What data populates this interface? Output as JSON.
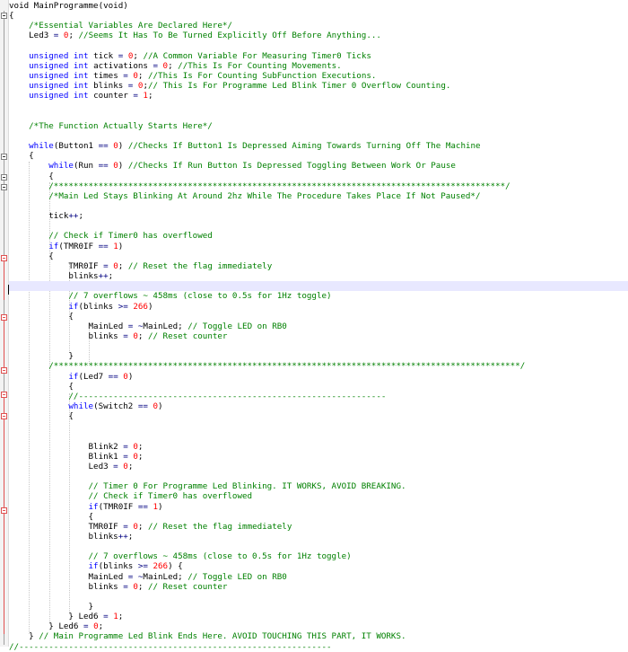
{
  "editor": {
    "colors": {
      "background": "#ffffff",
      "keyword": "#0000ff",
      "number": "#ff0000",
      "comment": "#008000",
      "text": "#000000",
      "current_line": "#e8e8ff",
      "fold_marker_changed": "#e05050"
    },
    "lines": [
      [
        [
          "t",
          "void MainProgramme(void)"
        ]
      ],
      [
        [
          "t",
          "{"
        ]
      ],
      [
        [
          "t",
          "    "
        ],
        [
          "c",
          "/*Essential Variables Are Declared Here*/"
        ]
      ],
      [
        [
          "t",
          "    Led3 "
        ],
        [
          "o",
          "="
        ],
        [
          "t",
          " "
        ],
        [
          "n",
          "0"
        ],
        [
          "t",
          "; "
        ],
        [
          "c",
          "//Seems It Has To Be Turned Explicitly Off Before Anything..."
        ]
      ],
      [],
      [
        [
          "t",
          "    "
        ],
        [
          "k",
          "unsigned int"
        ],
        [
          "t",
          " tick "
        ],
        [
          "o",
          "="
        ],
        [
          "t",
          " "
        ],
        [
          "n",
          "0"
        ],
        [
          "t",
          "; "
        ],
        [
          "c",
          "//A Common Variable For Measuring Timer0 Ticks"
        ]
      ],
      [
        [
          "t",
          "    "
        ],
        [
          "k",
          "unsigned int"
        ],
        [
          "t",
          " activations "
        ],
        [
          "o",
          "="
        ],
        [
          "t",
          " "
        ],
        [
          "n",
          "0"
        ],
        [
          "t",
          "; "
        ],
        [
          "c",
          "//This Is For Counting Movements."
        ]
      ],
      [
        [
          "t",
          "    "
        ],
        [
          "k",
          "unsigned int"
        ],
        [
          "t",
          " times "
        ],
        [
          "o",
          "="
        ],
        [
          "t",
          " "
        ],
        [
          "n",
          "0"
        ],
        [
          "t",
          "; "
        ],
        [
          "c",
          "//This Is For Counting SubFunction Executions."
        ]
      ],
      [
        [
          "t",
          "    "
        ],
        [
          "k",
          "unsigned int"
        ],
        [
          "t",
          " blinks "
        ],
        [
          "o",
          "="
        ],
        [
          "t",
          " "
        ],
        [
          "n",
          "0"
        ],
        [
          "t",
          ";"
        ],
        [
          "c",
          "// This Is For Programme Led Blink Timer 0 Overflow Counting."
        ]
      ],
      [
        [
          "t",
          "    "
        ],
        [
          "k",
          "unsigned int"
        ],
        [
          "t",
          " counter "
        ],
        [
          "o",
          "="
        ],
        [
          "t",
          " "
        ],
        [
          "n",
          "1"
        ],
        [
          "t",
          ";"
        ]
      ],
      [],
      [],
      [
        [
          "t",
          "    "
        ],
        [
          "c",
          "/*The Function Actually Starts Here*/"
        ]
      ],
      [],
      [
        [
          "t",
          "    "
        ],
        [
          "k",
          "while"
        ],
        [
          "t",
          "(Button1 "
        ],
        [
          "o",
          "=="
        ],
        [
          "t",
          " "
        ],
        [
          "n",
          "0"
        ],
        [
          "t",
          ") "
        ],
        [
          "c",
          "//Checks If Button1 Is Depressed Aiming Towards Turning Off The Machine"
        ]
      ],
      [
        [
          "t",
          "    {"
        ]
      ],
      [
        [
          "t",
          "        "
        ],
        [
          "k",
          "while"
        ],
        [
          "t",
          "(Run "
        ],
        [
          "o",
          "=="
        ],
        [
          "t",
          " "
        ],
        [
          "n",
          "0"
        ],
        [
          "t",
          ") "
        ],
        [
          "c",
          "//Checks If Run Button Is Depressed Toggling Between Work Or Pause"
        ]
      ],
      [
        [
          "t",
          "        {"
        ]
      ],
      [
        [
          "t",
          "        "
        ],
        [
          "c",
          "/*******************************************************************************************/"
        ]
      ],
      [
        [
          "t",
          "        "
        ],
        [
          "c",
          "/*Main Led Stays Blinking At Around 2hz While The Procedure Takes Place If Not Paused*/"
        ]
      ],
      [],
      [
        [
          "t",
          "        tick"
        ],
        [
          "o",
          "++"
        ],
        [
          "t",
          ";"
        ]
      ],
      [],
      [
        [
          "t",
          "        "
        ],
        [
          "c",
          "// Check if Timer0 has overflowed"
        ]
      ],
      [
        [
          "t",
          "        "
        ],
        [
          "k",
          "if"
        ],
        [
          "t",
          "(TMR0IF "
        ],
        [
          "o",
          "=="
        ],
        [
          "t",
          " "
        ],
        [
          "n",
          "1"
        ],
        [
          "t",
          ")"
        ]
      ],
      [
        [
          "t",
          "        {"
        ]
      ],
      [
        [
          "t",
          "            TMR0IF "
        ],
        [
          "o",
          "="
        ],
        [
          "t",
          " "
        ],
        [
          "n",
          "0"
        ],
        [
          "t",
          "; "
        ],
        [
          "c",
          "// Reset the flag immediately"
        ]
      ],
      [
        [
          "t",
          "            blinks"
        ],
        [
          "o",
          "++"
        ],
        [
          "t",
          ";"
        ]
      ],
      [],
      [
        [
          "t",
          "            "
        ],
        [
          "c",
          "// 7 overflows ~ 458ms (close to 0.5s for 1Hz toggle)"
        ]
      ],
      [
        [
          "t",
          "            "
        ],
        [
          "k",
          "if"
        ],
        [
          "t",
          "(blinks "
        ],
        [
          "o",
          ">="
        ],
        [
          "t",
          " "
        ],
        [
          "n",
          "266"
        ],
        [
          "t",
          ")"
        ]
      ],
      [
        [
          "t",
          "            {"
        ]
      ],
      [
        [
          "t",
          "                MainLed "
        ],
        [
          "o",
          "="
        ],
        [
          "t",
          " "
        ],
        [
          "o",
          "~"
        ],
        [
          "t",
          "MainLed; "
        ],
        [
          "c",
          "// Toggle LED on RB0"
        ]
      ],
      [
        [
          "t",
          "                blinks "
        ],
        [
          "o",
          "="
        ],
        [
          "t",
          " "
        ],
        [
          "n",
          "0"
        ],
        [
          "t",
          "; "
        ],
        [
          "c",
          "// Reset counter"
        ]
      ],
      [],
      [
        [
          "t",
          "            }"
        ]
      ],
      [
        [
          "t",
          "        "
        ],
        [
          "c",
          "/**********************************************************************************************/"
        ]
      ],
      [
        [
          "t",
          "            "
        ],
        [
          "k",
          "if"
        ],
        [
          "t",
          "(Led7 "
        ],
        [
          "o",
          "=="
        ],
        [
          "t",
          " "
        ],
        [
          "n",
          "0"
        ],
        [
          "t",
          ")"
        ]
      ],
      [
        [
          "t",
          "            {"
        ]
      ],
      [
        [
          "t",
          "            "
        ],
        [
          "c",
          "//--------------------------------------------------------------"
        ]
      ],
      [
        [
          "t",
          "            "
        ],
        [
          "k",
          "while"
        ],
        [
          "t",
          "(Switch2 "
        ],
        [
          "o",
          "=="
        ],
        [
          "t",
          " "
        ],
        [
          "n",
          "0"
        ],
        [
          "t",
          ")"
        ]
      ],
      [
        [
          "t",
          "            {"
        ]
      ],
      [],
      [],
      [
        [
          "t",
          "                Blink2 "
        ],
        [
          "o",
          "="
        ],
        [
          "t",
          " "
        ],
        [
          "n",
          "0"
        ],
        [
          "t",
          ";"
        ]
      ],
      [
        [
          "t",
          "                Blink1 "
        ],
        [
          "o",
          "="
        ],
        [
          "t",
          " "
        ],
        [
          "n",
          "0"
        ],
        [
          "t",
          ";"
        ]
      ],
      [
        [
          "t",
          "                Led3 "
        ],
        [
          "o",
          "="
        ],
        [
          "t",
          " "
        ],
        [
          "n",
          "0"
        ],
        [
          "t",
          ";"
        ]
      ],
      [],
      [
        [
          "t",
          "                "
        ],
        [
          "c",
          "// Timer 0 For Programme Led Blinking. IT WORKS, AVOID BREAKING."
        ]
      ],
      [
        [
          "t",
          "                "
        ],
        [
          "c",
          "// Check if Timer0 has overflowed"
        ]
      ],
      [
        [
          "t",
          "                "
        ],
        [
          "k",
          "if"
        ],
        [
          "t",
          "(TMR0IF "
        ],
        [
          "o",
          "=="
        ],
        [
          "t",
          " "
        ],
        [
          "n",
          "1"
        ],
        [
          "t",
          ")"
        ]
      ],
      [
        [
          "t",
          "                {"
        ]
      ],
      [
        [
          "t",
          "                TMR0IF "
        ],
        [
          "o",
          "="
        ],
        [
          "t",
          " "
        ],
        [
          "n",
          "0"
        ],
        [
          "t",
          "; "
        ],
        [
          "c",
          "// Reset the flag immediately"
        ]
      ],
      [
        [
          "t",
          "                blinks"
        ],
        [
          "o",
          "++"
        ],
        [
          "t",
          ";"
        ]
      ],
      [],
      [
        [
          "t",
          "                "
        ],
        [
          "c",
          "// 7 overflows ~ 458ms (close to 0.5s for 1Hz toggle)"
        ]
      ],
      [
        [
          "t",
          "                "
        ],
        [
          "k",
          "if"
        ],
        [
          "t",
          "(blinks "
        ],
        [
          "o",
          ">="
        ],
        [
          "t",
          " "
        ],
        [
          "n",
          "266"
        ],
        [
          "t",
          ") {"
        ]
      ],
      [
        [
          "t",
          "                MainLed "
        ],
        [
          "o",
          "="
        ],
        [
          "t",
          " "
        ],
        [
          "o",
          "~"
        ],
        [
          "t",
          "MainLed; "
        ],
        [
          "c",
          "// Toggle LED on RB0"
        ]
      ],
      [
        [
          "t",
          "                blinks "
        ],
        [
          "o",
          "="
        ],
        [
          "t",
          " "
        ],
        [
          "n",
          "0"
        ],
        [
          "t",
          "; "
        ],
        [
          "c",
          "// Reset counter"
        ]
      ],
      [],
      [
        [
          "t",
          "                }"
        ]
      ],
      [
        [
          "t",
          "            } Led6 "
        ],
        [
          "o",
          "="
        ],
        [
          "t",
          " "
        ],
        [
          "n",
          "1"
        ],
        [
          "t",
          ";"
        ]
      ],
      [
        [
          "t",
          "        } Led6 "
        ],
        [
          "o",
          "="
        ],
        [
          "t",
          " "
        ],
        [
          "n",
          "0"
        ],
        [
          "t",
          ";"
        ]
      ],
      [
        [
          "t",
          "    } "
        ],
        [
          "c",
          "// Main Programme Led Blink Ends Here. AVOID TOUCHING THIS PART, IT WORKS."
        ]
      ],
      [
        [
          "c",
          "//---------------------------------------------------------------"
        ]
      ]
    ]
  }
}
